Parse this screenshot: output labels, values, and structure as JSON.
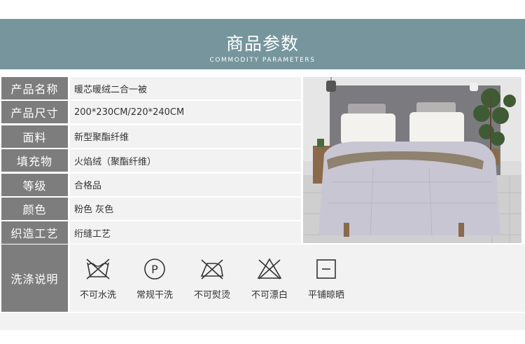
{
  "header": {
    "title": "商品参数",
    "subtitle": "COMMODITY PARAMETERS"
  },
  "params": [
    {
      "label": "产品名称",
      "value": "暖芯暖绒二合一被"
    },
    {
      "label": "产品尺寸",
      "value": "200*230CM/220*240CM"
    },
    {
      "label": "面料",
      "value": "新型聚酯纤维"
    },
    {
      "label": "填充物",
      "value": "火焰绒（聚酯纤维）"
    },
    {
      "label": "等级",
      "value": "合格品"
    },
    {
      "label": "颜色",
      "value": "粉色 灰色"
    },
    {
      "label": "织造工艺",
      "value": "绗缝工艺"
    }
  ],
  "wash": {
    "label": "洗涤说明",
    "items": [
      {
        "icon": "no-wash-icon",
        "caption": "不可水洗"
      },
      {
        "icon": "dry-clean-icon",
        "caption": "常规干洗"
      },
      {
        "icon": "no-iron-icon",
        "caption": "不可熨烫"
      },
      {
        "icon": "no-bleach-icon",
        "caption": "不可漂白"
      },
      {
        "icon": "flat-dry-icon",
        "caption": "平铺晾晒"
      }
    ]
  },
  "colors": {
    "header_bg": "#76959c",
    "label_bg": "#7d7d7d",
    "value_bg": "#f2f2f2"
  }
}
